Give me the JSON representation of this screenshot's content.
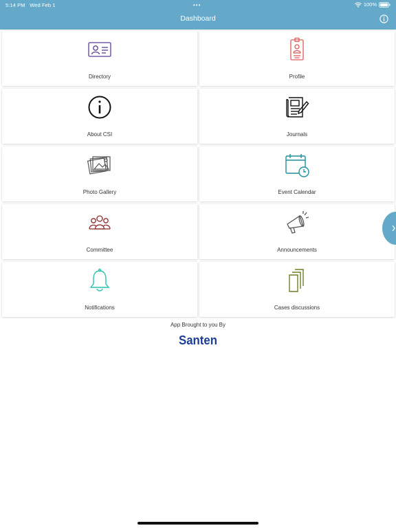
{
  "status_bar": {
    "time": "5:14 PM",
    "date": "Wed Feb 1",
    "dots": "•••",
    "battery": "100%"
  },
  "header": {
    "title": "Dashboard",
    "icon": "info-icon"
  },
  "tiles": [
    {
      "label": "Directory",
      "icon": "id-card-icon",
      "color": "#5b3f96"
    },
    {
      "label": "Profile",
      "icon": "id-badge-icon",
      "color": "#e05a5a"
    },
    {
      "label": "About CSI",
      "icon": "info-circle-icon",
      "color": "#111111"
    },
    {
      "label": "Journals",
      "icon": "newspaper-pen-icon",
      "color": "#111111"
    },
    {
      "label": "Photo Gallery",
      "icon": "photo-stack-icon",
      "color": "#555555"
    },
    {
      "label": "Event Calendar",
      "icon": "calendar-clock-icon",
      "color": "#1f8f9a"
    },
    {
      "label": "Committee",
      "icon": "people-group-icon",
      "color": "#8b2a2a"
    },
    {
      "label": "Announcements",
      "icon": "megaphone-icon",
      "color": "#555555"
    },
    {
      "label": "Notifications",
      "icon": "bell-icon",
      "color": "#2bbfb3"
    },
    {
      "label": "Cases discussions",
      "icon": "documents-icon",
      "color": "#6b7f26"
    }
  ],
  "footer": {
    "text": "App Brought to you By",
    "logo_text": "Santen",
    "logo_color": "#1b3f95"
  },
  "colors": {
    "header_bg": "#64a9c9"
  }
}
